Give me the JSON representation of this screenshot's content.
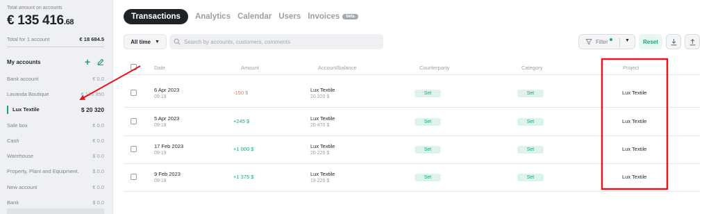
{
  "sidebar": {
    "total_label": "Total amount on accounts",
    "total_main": "€ 135 416",
    "total_cents": ".68",
    "sub_label": "Total for 1 account",
    "sub_value": "€ 18 684.5",
    "accounts_title": "My accounts",
    "items": [
      {
        "label": "Bank account",
        "amount": "€ 0.0"
      },
      {
        "label": "Lavanda Boutique",
        "amount": "€ 126 950"
      },
      {
        "label": "Lux Textile",
        "amount": "$ 20 320"
      },
      {
        "label": "Safe box",
        "amount": "€ 0.0"
      },
      {
        "label": "Cash",
        "amount": "€ 0.0"
      },
      {
        "label": "Warehouse",
        "amount": "$ 0.0"
      },
      {
        "label": "Property, Plant and Equipment.",
        "amount": "$ 0.0"
      },
      {
        "label": "New account",
        "amount": "€ 0.0"
      },
      {
        "label": "Bank",
        "amount": "$ 0.0"
      }
    ]
  },
  "tabs": [
    {
      "label": "Transactions",
      "active": true
    },
    {
      "label": "Analytics"
    },
    {
      "label": "Calendar"
    },
    {
      "label": "Users"
    },
    {
      "label": "Invoices",
      "badge": "beta"
    }
  ],
  "toolbar": {
    "period": "All time",
    "search_placeholder": "Search by accounts, customers, comments",
    "filter_label": "Filter",
    "reset_label": "Reset"
  },
  "table": {
    "headers": [
      "Date",
      "Amount",
      "Account/balance",
      "Counterparty",
      "Category",
      "Project"
    ],
    "rows": [
      {
        "date": "6 Apr 2023",
        "time": "09:19",
        "amount": "-150  $",
        "account": "Lux Textile",
        "balance": "20 320  $",
        "counterparty": "Set",
        "category": "Set",
        "project": "Lux Textile"
      },
      {
        "date": "5 Apr 2023",
        "time": "09:18",
        "amount": "+245  $",
        "account": "Lux Textile",
        "balance": "20 470  $",
        "counterparty": "Set",
        "category": "Set",
        "project": "Lux Textile"
      },
      {
        "date": "17 Feb 2023",
        "time": "09:19",
        "amount": "+1 000  $",
        "account": "Lux Textile",
        "balance": "20 225  $",
        "counterparty": "Set",
        "category": "Set",
        "project": "Lux Textile"
      },
      {
        "date": "9 Feb 2023",
        "time": "09:18",
        "amount": "+1 375  $",
        "account": "Lux Textile",
        "balance": "19 225  $",
        "counterparty": "Set",
        "category": "Set",
        "project": "Lux Textile"
      }
    ]
  },
  "colors": {
    "accent": "#1aa37a",
    "negative": "#f07b3f",
    "annotation": "#e8141b"
  }
}
